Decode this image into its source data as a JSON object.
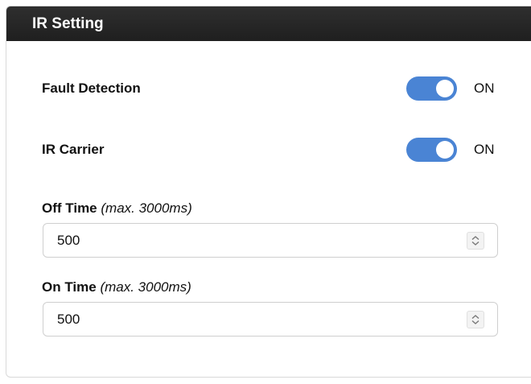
{
  "panel": {
    "title": "IR Setting"
  },
  "settings": {
    "fault_detection": {
      "label": "Fault Detection",
      "state": "ON",
      "enabled": true
    },
    "ir_carrier": {
      "label": "IR Carrier",
      "state": "ON",
      "enabled": true
    }
  },
  "fields": {
    "off_time": {
      "label": "Off Time",
      "hint": "(max. 3000ms)",
      "value": "500"
    },
    "on_time": {
      "label": "On Time",
      "hint": "(max. 3000ms)",
      "value": "500"
    }
  },
  "icons": {
    "stepper": "up-down-chevron-icon"
  },
  "colors": {
    "header_bg": "#262626",
    "toggle_on": "#4a84d4"
  }
}
